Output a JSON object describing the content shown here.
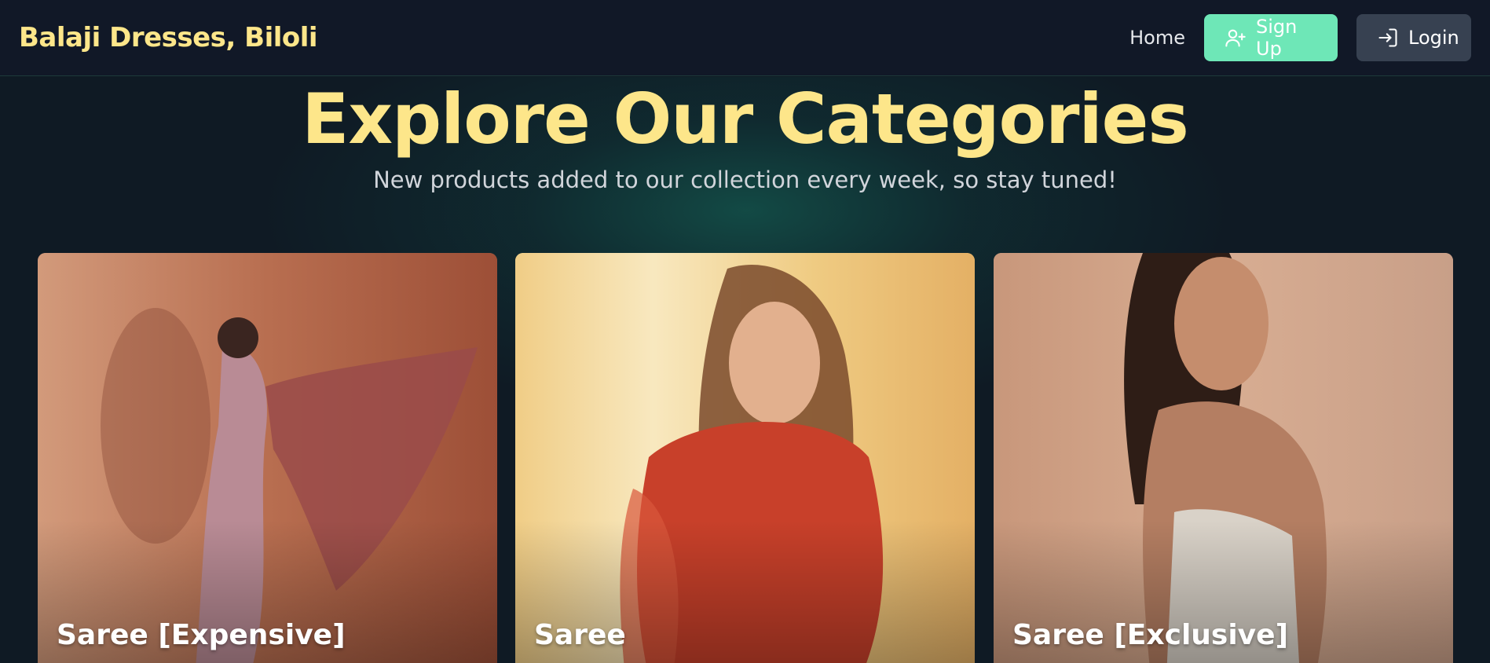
{
  "navbar": {
    "brand": "Balaji Dresses, Biloli",
    "home_label": "Home",
    "signup_label": "Sign Up",
    "login_label": "Login"
  },
  "hero": {
    "title": "Explore Our Categories",
    "subtitle": "New products added to our collection every week, so stay tuned!"
  },
  "categories": [
    {
      "label": "Saree [Expensive]"
    },
    {
      "label": "Saree"
    },
    {
      "label": "Saree [Exclusive]"
    }
  ],
  "colors": {
    "brand": "#fde68a",
    "navbar_bg": "#111827",
    "signup_bg": "#6ee7b7",
    "login_bg": "#374151",
    "page_bg": "#0f1a24"
  },
  "icons": {
    "signup": "user-plus-icon",
    "login": "login-arrow-icon"
  }
}
